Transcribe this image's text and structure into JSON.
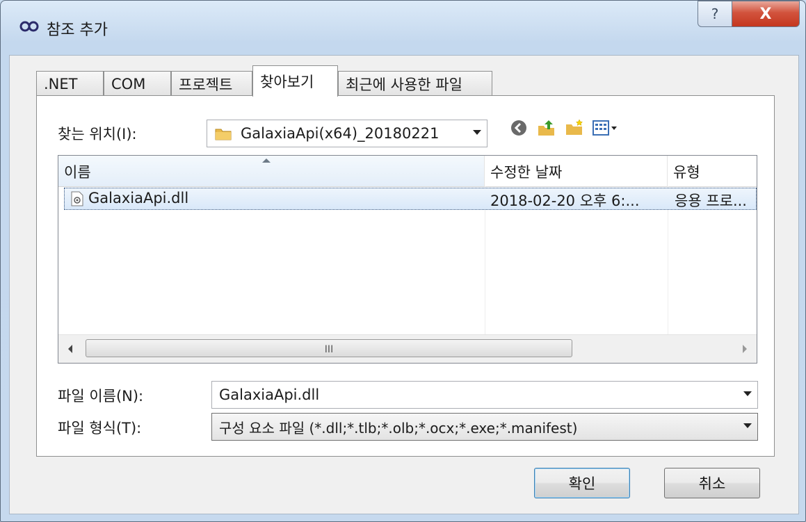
{
  "window": {
    "title": "참조 추가",
    "help_label": "?",
    "close_label": "X"
  },
  "tabs": [
    {
      "label": ".NET",
      "active": false
    },
    {
      "label": "COM",
      "active": false
    },
    {
      "label": "프로젝트",
      "active": false
    },
    {
      "label": "찾아보기",
      "active": true
    },
    {
      "label": "최근에 사용한 파일",
      "active": false
    }
  ],
  "browse": {
    "look_in_label": "찾는 위치(I):",
    "look_in_value": "GalaxiaApi(x64)_20180221",
    "toolbar_icons": [
      "back-icon",
      "up-folder-icon",
      "new-folder-icon",
      "view-menu-icon"
    ]
  },
  "file_list": {
    "columns": [
      "이름",
      "수정한 날짜",
      "유형"
    ],
    "rows": [
      {
        "name": "GalaxiaApi.dll",
        "modified": "2018-02-20 오후 6:...",
        "type": "응용 프로..."
      }
    ],
    "scroll_grip": "III"
  },
  "filename": {
    "label": "파일 이름(N):",
    "value": "GalaxiaApi.dll"
  },
  "filetype": {
    "label": "파일 형식(T):",
    "value": "구성 요소 파일 (*.dll;*.tlb;*.olb;*.ocx;*.exe;*.manifest)"
  },
  "buttons": {
    "ok": "확인",
    "cancel": "취소"
  },
  "colors": {
    "selection": "#d9e8f9",
    "titlebar": "#c4d8ee",
    "close": "#c4371f"
  }
}
